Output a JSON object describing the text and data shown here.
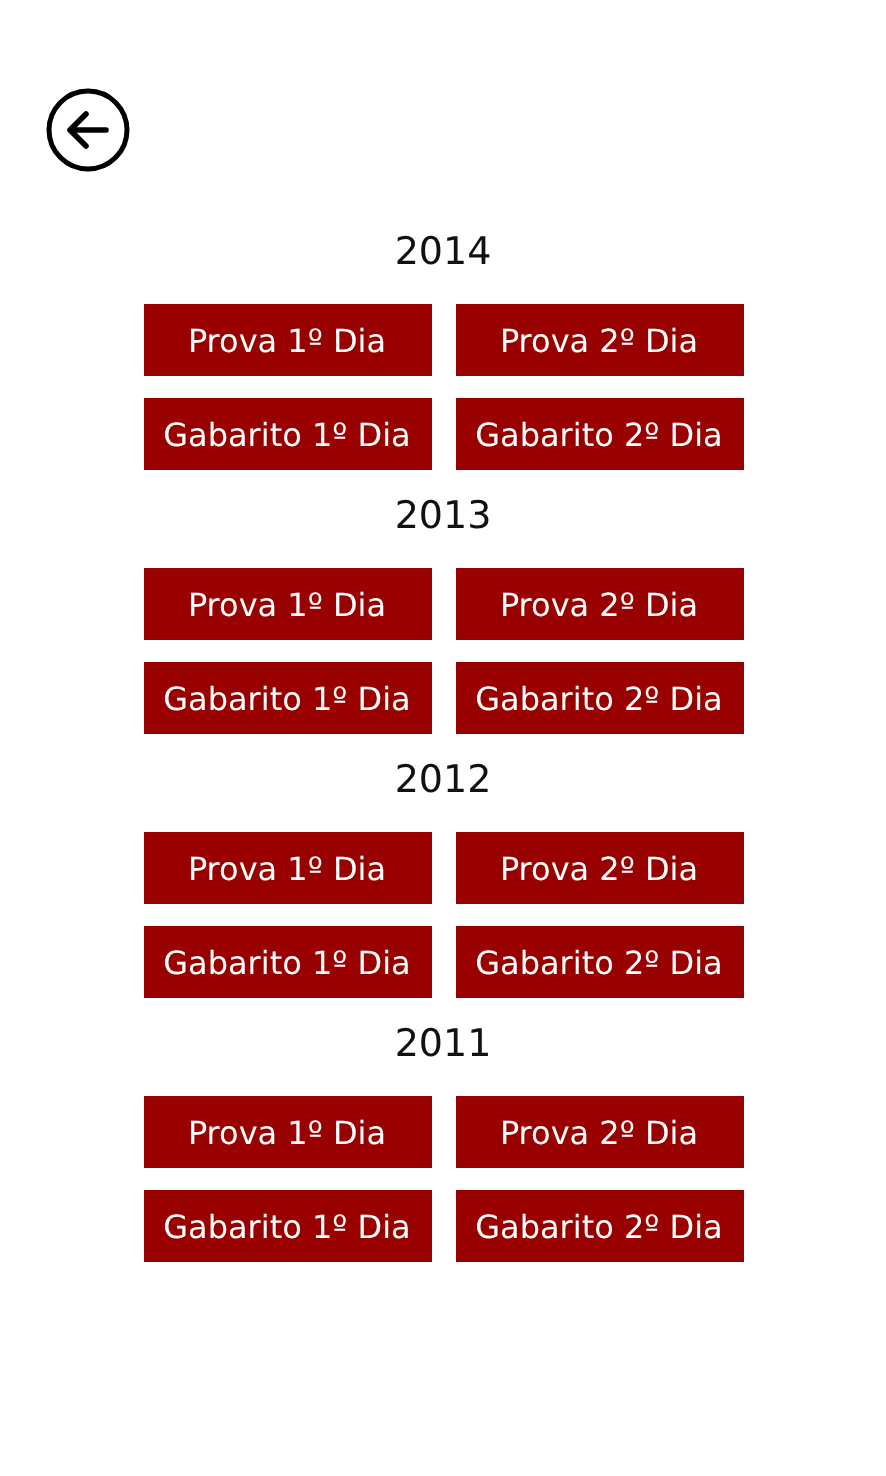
{
  "sections": [
    {
      "year": "2014",
      "buttons": [
        "Prova 1º Dia",
        "Prova 2º Dia",
        "Gabarito 1º Dia",
        "Gabarito 2º Dia"
      ]
    },
    {
      "year": "2013",
      "buttons": [
        "Prova 1º Dia",
        "Prova 2º Dia",
        "Gabarito 1º Dia",
        "Gabarito 2º Dia"
      ]
    },
    {
      "year": "2012",
      "buttons": [
        "Prova 1º Dia",
        "Prova 2º Dia",
        "Gabarito 1º Dia",
        "Gabarito 2º Dia"
      ]
    },
    {
      "year": "2011",
      "buttons": [
        "Prova 1º Dia",
        "Prova 2º Dia",
        "Gabarito 1º Dia",
        "Gabarito 2º Dia"
      ]
    }
  ]
}
